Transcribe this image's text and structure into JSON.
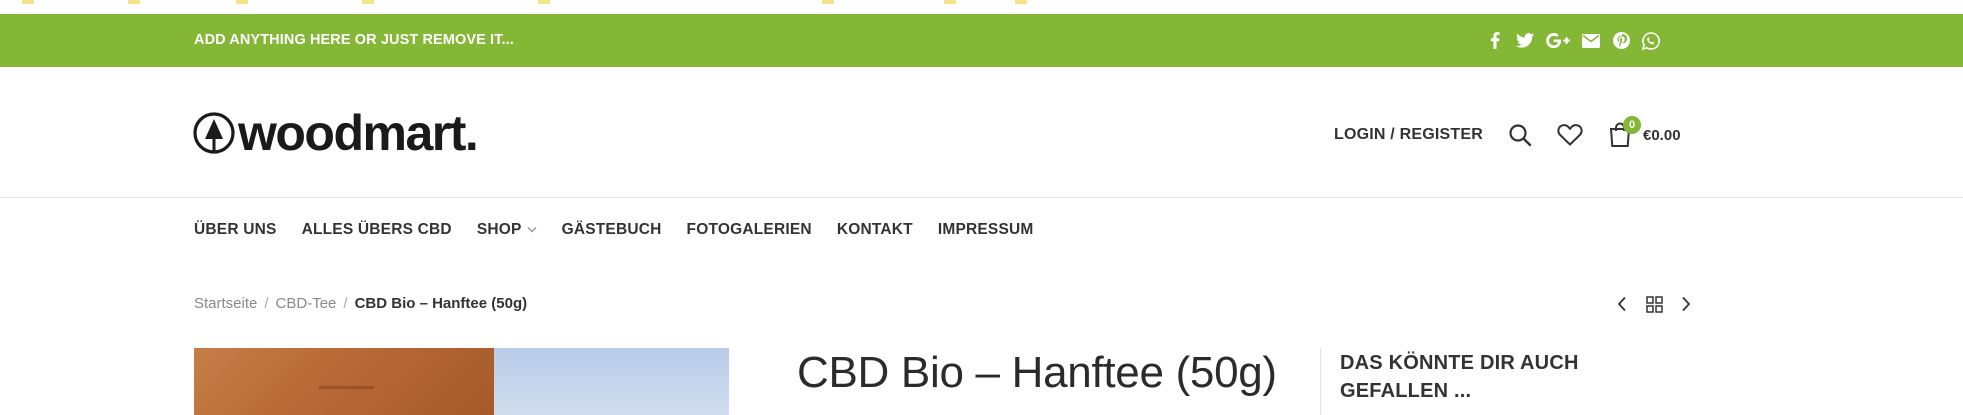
{
  "topbar": {
    "promo_text": "ADD ANYTHING HERE OR JUST REMOVE IT...",
    "social": [
      {
        "icon": "facebook-icon",
        "glyph": "f"
      },
      {
        "icon": "twitter-icon",
        "glyph": "t"
      },
      {
        "icon": "google-plus-icon",
        "glyph": "G+"
      },
      {
        "icon": "email-icon",
        "glyph": "✉"
      },
      {
        "icon": "pinterest-icon",
        "glyph": "p"
      },
      {
        "icon": "whatsapp-icon",
        "glyph": "w"
      }
    ],
    "bg_color": "#83b735"
  },
  "header": {
    "logo_text": "woodmart.",
    "login_label": "LOGIN / REGISTER",
    "cart_count": "0",
    "cart_total": "€0.00",
    "icons": [
      "search-icon",
      "heart-icon",
      "shopping-bag-icon"
    ]
  },
  "nav": {
    "items": [
      "ÜBER UNS",
      "ALLES ÜBERS CBD",
      "SHOP",
      "GÄSTEBUCH",
      "FOTOGALERIEN",
      "KONTAKT",
      "IMPRESSUM"
    ]
  },
  "breadcrumb": {
    "items": [
      "Startseite",
      "CBD-Tee"
    ],
    "current": "CBD Bio – Hanftee (50g)"
  },
  "product": {
    "title": "CBD Bio – Hanftee (50g)"
  },
  "sidebar": {
    "title": "DAS KÖNNTE DIR AUCH GEFALLEN ..."
  },
  "accent_color": "#83b735"
}
